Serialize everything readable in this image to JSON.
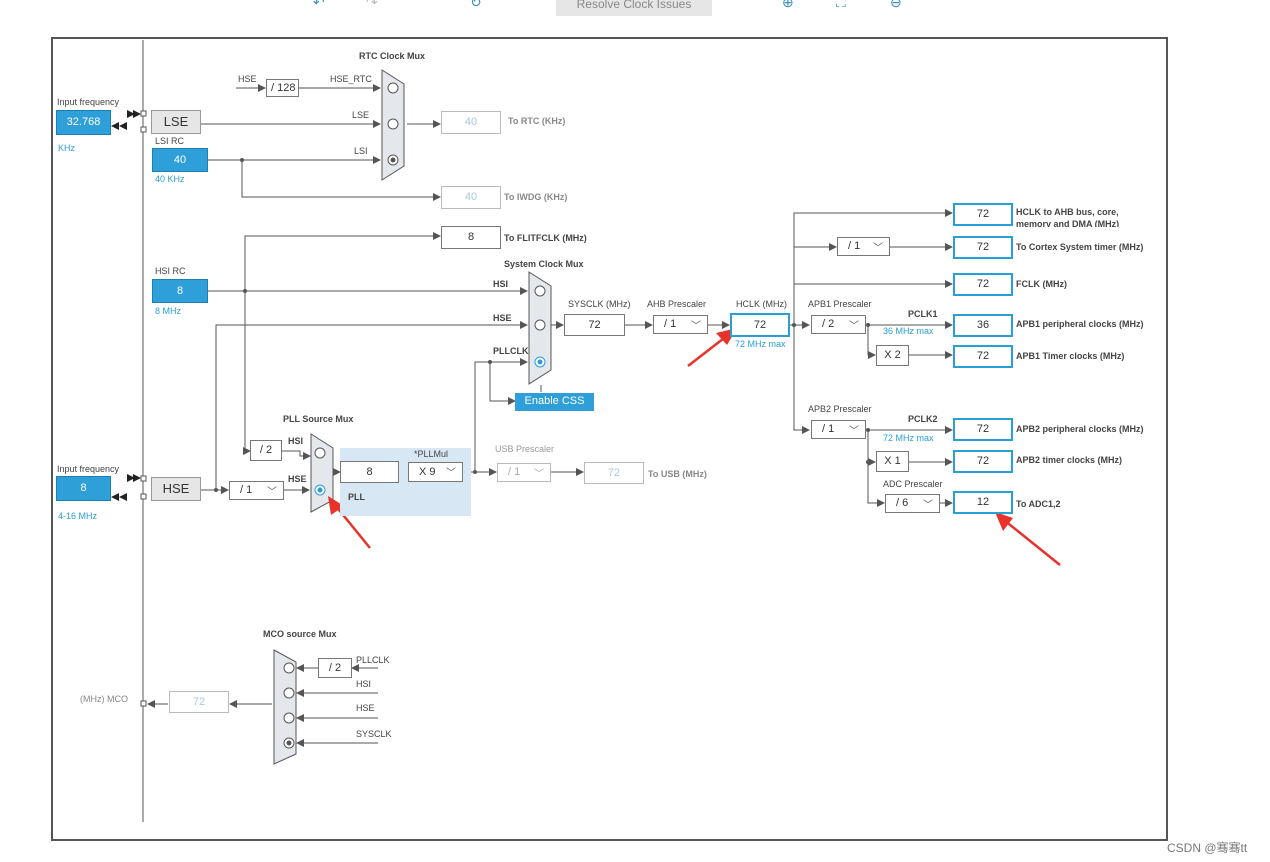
{
  "toolbar": {
    "resolve_label": "Resolve Clock Issues"
  },
  "rtc_mux": {
    "title": "RTC Clock Mux",
    "hse_div": "/ 128",
    "hse_in": "HSE",
    "hse_rtc": "HSE_RTC",
    "lse": "LSE",
    "lsi": "LSI"
  },
  "lse": {
    "input_label": "Input frequency",
    "freq": "32.768",
    "unit": "KHz",
    "name": "LSE"
  },
  "lsi": {
    "label": "LSI RC",
    "value": "40",
    "unit": "40 KHz"
  },
  "rtc_out": {
    "value": "40",
    "label": "To RTC (KHz)"
  },
  "iwdg_out": {
    "value": "40",
    "label": "To IWDG (KHz)"
  },
  "flit_out": {
    "value": "8",
    "label": "To FLITFCLK (MHz)"
  },
  "hsi": {
    "label": "HSI RC",
    "value": "8",
    "unit": "8 MHz"
  },
  "sys_mux": {
    "title": "System Clock Mux",
    "hsi": "HSI",
    "hse": "HSE",
    "pllclk": "PLLCLK",
    "css": "Enable CSS"
  },
  "sysclk": {
    "label": "SYSCLK (MHz)",
    "value": "72"
  },
  "ahb": {
    "label": "AHB Prescaler",
    "value": "/ 1"
  },
  "hclk": {
    "label": "HCLK (MHz)",
    "value": "72",
    "max": "72 MHz max"
  },
  "apb1": {
    "label": "APB1 Prescaler",
    "value": "/ 2",
    "pclk": "PCLK1",
    "max": "36 MHz max",
    "timer_mult": "X 2"
  },
  "apb2": {
    "label": "APB2 Prescaler",
    "value": "/ 1",
    "pclk": "PCLK2",
    "max": "72 MHz max",
    "timer_mult": "X 1"
  },
  "adc": {
    "label": "ADC Prescaler",
    "value": "/ 6"
  },
  "cortex_div": "/ 1",
  "outputs": [
    {
      "value": "72",
      "label": "HCLK to AHB bus, core,",
      "label2": "memory and DMA (MHz)"
    },
    {
      "value": "72",
      "label": "To Cortex System timer (MHz)"
    },
    {
      "value": "72",
      "label": "FCLK (MHz)"
    },
    {
      "value": "36",
      "label": "APB1 peripheral clocks (MHz)"
    },
    {
      "value": "72",
      "label": "APB1 Timer clocks (MHz)"
    },
    {
      "value": "72",
      "label": "APB2 peripheral clocks (MHz)"
    },
    {
      "value": "72",
      "label": "APB2 timer clocks (MHz)"
    },
    {
      "value": "12",
      "label": "To ADC1,2"
    }
  ],
  "pll_src": {
    "title": "PLL Source Mux",
    "hsi": "HSI",
    "hse": "HSE",
    "hsi_div": "/ 2"
  },
  "pll": {
    "mul_label": "*PLLMul",
    "input": "8",
    "mul": "X 9",
    "name": "PLL"
  },
  "usb": {
    "label": "USB Prescaler",
    "value": "/ 1",
    "out": "72",
    "out_label": "To USB (MHz)"
  },
  "hse": {
    "input_label": "Input frequency",
    "freq": "8",
    "range": "4-16 MHz",
    "name": "HSE",
    "div": "/ 1"
  },
  "mco": {
    "title": "MCO source Mux",
    "pll_div": "/ 2",
    "pllclk": "PLLCLK",
    "hsi": "HSI",
    "hse": "HSE",
    "sysclk": "SYSCLK",
    "out_label": "(MHz) MCO",
    "value": "72"
  },
  "watermark": "CSDN @骞骞tt",
  "colors": {
    "accent": "#2e9fd9",
    "arrow": "#e8322c"
  }
}
